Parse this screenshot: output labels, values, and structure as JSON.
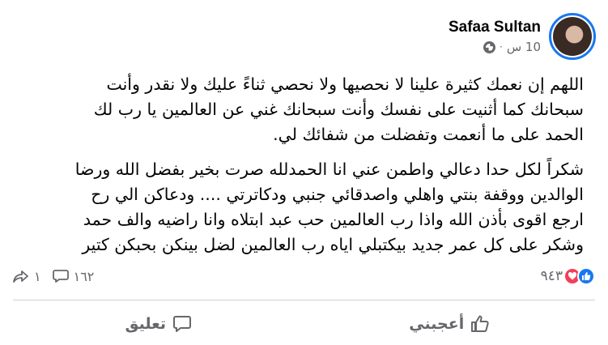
{
  "post": {
    "author": "Safaa Sultan",
    "time": "10 س",
    "separator": "·",
    "privacy_icon": "globe-icon",
    "paragraphs": [
      [
        "اللهم إن نعمك كثيرة علينا لا نحصيها ولا نحصي ثناءً عليك ولا نقدر وأنت",
        "سبحانك كما أثنيت على نفسك وأنت سبحانك غني عن العالمين يا رب لك",
        "الحمد على ما أنعمت وتفضلت من شفائك لي."
      ],
      [
        "شكراً لكل حدا دعالي واطمن عني انا الحمدلله صرت بخير بفضل الله ورضا",
        "الوالدين ووقفة بنتي واهلي واصدقائي جنبي ودكاترتي .... ودعاكن الي رح",
        "ارجع اقوى بأذن الله واذا رب العالمين حب عبد ابتلاه وانا راضيه والف حمد",
        "وشكر على كل عمر جديد بيكتبلي اياه رب العالمين لضل بينكن بحبكن كتير"
      ]
    ]
  },
  "stats": {
    "reactions_count": "٩٤٣",
    "comments_count": "١٦٢",
    "shares_count": "١"
  },
  "actions": {
    "like_label": "أعجبني",
    "comment_label": "تعليق"
  },
  "colors": {
    "like_blue": "#1877f2",
    "love_red": "#f33e58",
    "muted_text": "#65676b",
    "avatar_ring": "#1877f2"
  }
}
